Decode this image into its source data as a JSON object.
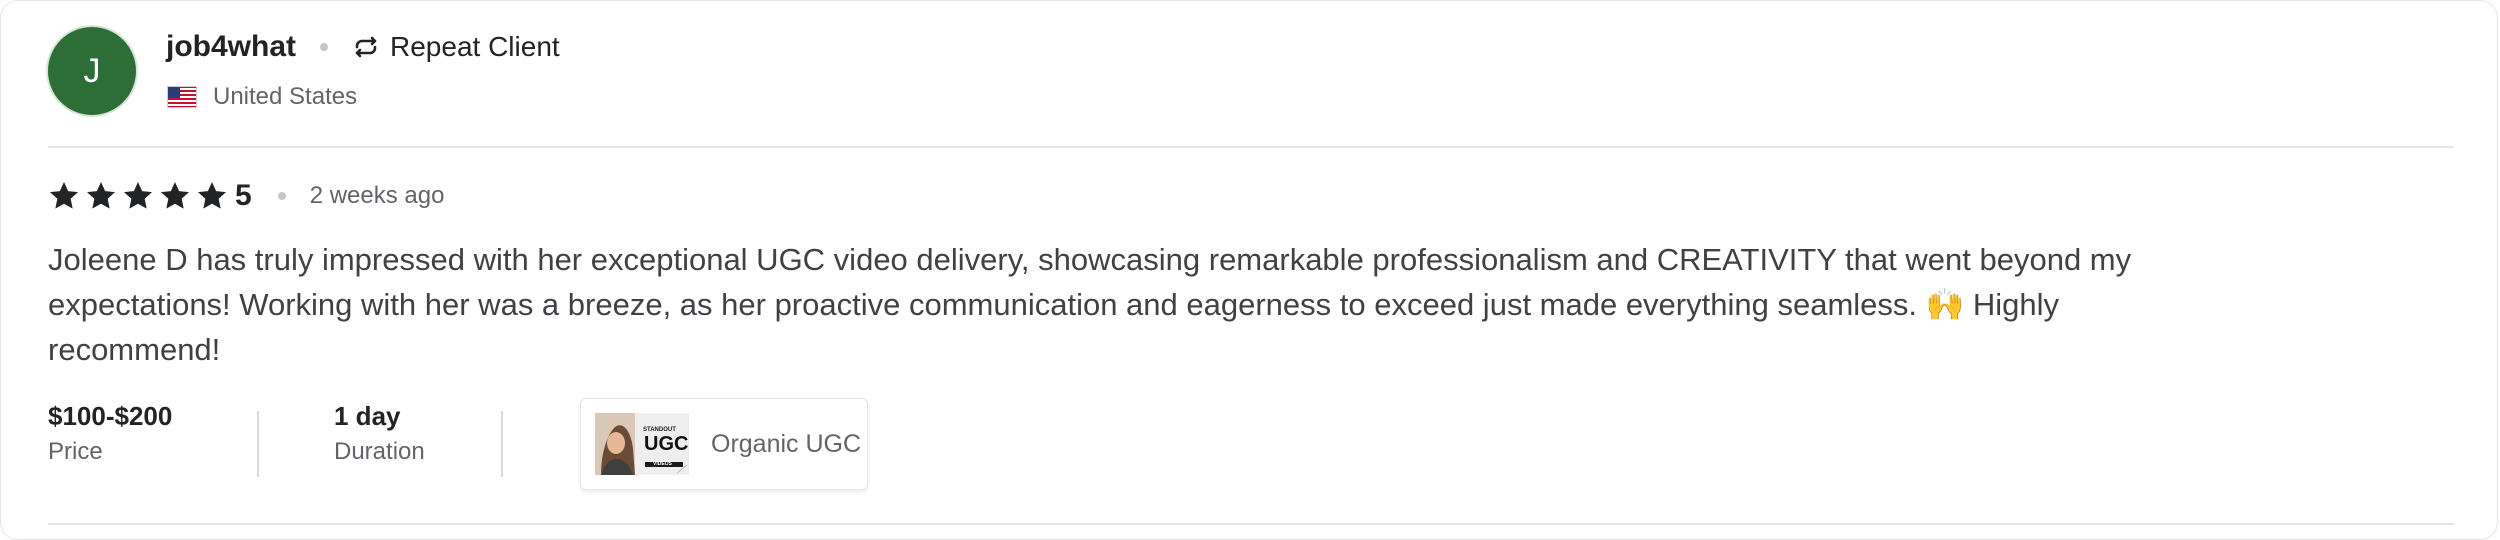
{
  "reviewer": {
    "avatar_initial": "J",
    "username": "job4what",
    "badge_label": "Repeat Client",
    "country": "United States",
    "avatar_color": "#2c6e35"
  },
  "rating": {
    "stars": 5,
    "value": "5",
    "time_ago": "2 weeks ago"
  },
  "review": {
    "text": "Joleene D has truly impressed with her exceptional UGC video delivery, showcasing remarkable professionalism and CREATIVITY that went beyond my expectations! Working with her was a breeze, as her proactive communication and eagerness to exceed just made everything seamless. 🙌 Highly recommend!"
  },
  "meta": {
    "price_value": "$100-$200",
    "price_label": "Price",
    "duration_value": "1 day",
    "duration_label": "Duration",
    "gig_label": "Organic UGC",
    "gig_thumb_text_top": "STANDOUT",
    "gig_thumb_text_main": "UGC",
    "gig_thumb_text_bottom": "VIDEOS"
  },
  "icons": {
    "repeat": "repeat-icon",
    "flag": "us-flag-icon",
    "star": "star-icon"
  }
}
